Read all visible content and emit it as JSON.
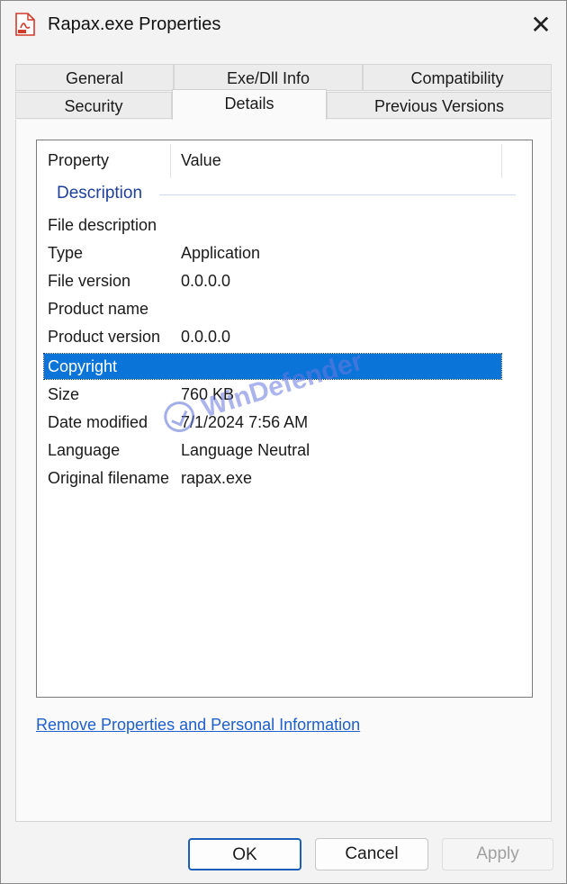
{
  "window": {
    "title": "Rapax.exe Properties",
    "app_icon": "pdf-document-icon",
    "close_glyph": "✕"
  },
  "tabs": [
    {
      "label": "General",
      "active": false
    },
    {
      "label": "Exe/Dll Info",
      "active": false
    },
    {
      "label": "Compatibility",
      "active": false
    },
    {
      "label": "Security",
      "active": false
    },
    {
      "label": "Details",
      "active": true
    },
    {
      "label": "Previous Versions",
      "active": false
    }
  ],
  "details": {
    "columns": {
      "property": "Property",
      "value": "Value"
    },
    "group_label": "Description",
    "rows": [
      {
        "property": "File description",
        "value": ""
      },
      {
        "property": "Type",
        "value": "Application"
      },
      {
        "property": "File version",
        "value": "0.0.0.0"
      },
      {
        "property": "Product name",
        "value": ""
      },
      {
        "property": "Product version",
        "value": "0.0.0.0"
      },
      {
        "property": "Copyright",
        "value": "",
        "selected": true
      },
      {
        "property": "Size",
        "value": "760 KB"
      },
      {
        "property": "Date modified",
        "value": "7/1/2024 7:56 AM"
      },
      {
        "property": "Language",
        "value": "Language Neutral"
      },
      {
        "property": "Original filename",
        "value": "rapax.exe"
      }
    ]
  },
  "remove_link": "Remove Properties and Personal Information",
  "watermark": {
    "text": "WinDefender",
    "icon": "checkmark-circle-icon"
  },
  "buttons": {
    "ok": "OK",
    "cancel": "Cancel",
    "apply": "Apply"
  },
  "colors": {
    "selection": "#0a74d8",
    "group_header": "#1f3f9c",
    "link": "#1f5fcc"
  }
}
